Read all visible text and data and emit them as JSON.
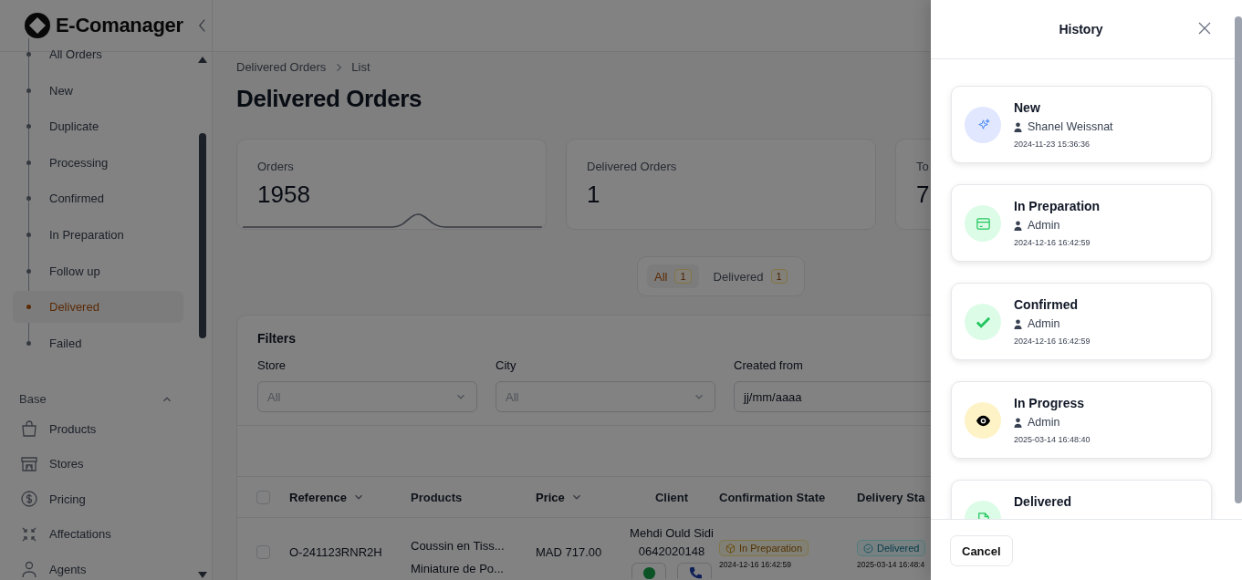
{
  "app": {
    "logo": "E-Comanager"
  },
  "sidebar": {
    "order_items": [
      {
        "label": "All Orders",
        "selected": false
      },
      {
        "label": "New",
        "selected": false
      },
      {
        "label": "Duplicate",
        "selected": false
      },
      {
        "label": "Processing",
        "selected": false
      },
      {
        "label": "Confirmed",
        "selected": false
      },
      {
        "label": "In Preparation",
        "selected": false
      },
      {
        "label": "Follow up",
        "selected": false
      },
      {
        "label": "Delivered",
        "selected": true
      },
      {
        "label": "Failed",
        "selected": false
      }
    ],
    "section": {
      "title": "Base",
      "expanded": true
    },
    "base_items": [
      {
        "label": "Products",
        "kind": "bag"
      },
      {
        "label": "Stores",
        "kind": "store"
      },
      {
        "label": "Pricing",
        "kind": "dollar"
      },
      {
        "label": "Affectations",
        "kind": "arrows"
      },
      {
        "label": "Agents",
        "kind": "user"
      }
    ]
  },
  "breadcrumbs": [
    "Delivered Orders",
    "List"
  ],
  "page_title": "Delivered Orders",
  "stats": [
    {
      "label": "Orders",
      "value": "1958",
      "trend": true
    },
    {
      "label": "Delivered Orders",
      "value": "1",
      "trend": false
    },
    {
      "label": "To",
      "value": "7",
      "trend": false
    }
  ],
  "status_tabs": [
    {
      "label": "All",
      "count": "1",
      "selected": true
    },
    {
      "label": "Delivered",
      "count": "1",
      "selected": false
    }
  ],
  "filters": {
    "title": "Filters",
    "fields": [
      {
        "label": "Store",
        "kind": "select",
        "placeholder": "All"
      },
      {
        "label": "City",
        "kind": "select",
        "placeholder": "All"
      },
      {
        "label": "Created from",
        "kind": "date",
        "value": "jj/mm/aaaa"
      }
    ]
  },
  "table": {
    "select_all_checked": false,
    "columns": [
      {
        "label": "Reference",
        "sortable": true
      },
      {
        "label": "Products",
        "sortable": false
      },
      {
        "label": "Price",
        "sortable": true
      },
      {
        "label": "Client",
        "sortable": false
      },
      {
        "label": "Confirmation State",
        "sortable": false
      },
      {
        "label": "Delivery Sta"
      }
    ],
    "rows": [
      {
        "checked": false,
        "reference": "O-241123RNR2H",
        "products": [
          "Coussin en Tiss...",
          "Miniature de Po..."
        ],
        "price": "MAD 717.00",
        "client_name": "Mehdi Ould Sidi",
        "client_phone": "0642020148",
        "confirmation": {
          "label": "In Preparation",
          "kind": "preparation",
          "date": "2024-12-16 16:42:59"
        },
        "delivery": {
          "label": "Delivered",
          "kind": "delivered",
          "date": "2025-03-14 16:48:4"
        }
      }
    ]
  },
  "history": {
    "title": "History",
    "entries": [
      {
        "kind": "new",
        "title": "New",
        "user": "Shanel Weissnat",
        "time": "2024-11-23 15:36:36"
      },
      {
        "kind": "preparation",
        "title": "In Preparation",
        "user": "Admin",
        "time": "2024-12-16 16:42:59"
      },
      {
        "kind": "confirmed",
        "title": "Confirmed",
        "user": "Admin",
        "time": "2024-12-16 16:42:59"
      },
      {
        "kind": "progress",
        "title": "In Progress",
        "user": "Admin",
        "time": "2025-03-14 16:48:40"
      },
      {
        "kind": "delivered",
        "title": "Delivered"
      }
    ],
    "cancel": "Cancel"
  }
}
